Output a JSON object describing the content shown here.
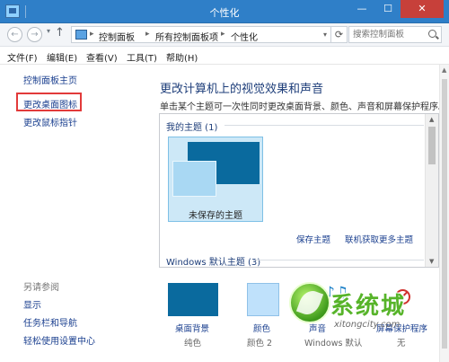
{
  "window": {
    "title": "个性化",
    "minimize_glyph": "—",
    "maximize_glyph": "☐",
    "close_glyph": "✕"
  },
  "address": {
    "back_glyph": "←",
    "forward_glyph": "→",
    "up_glyph": "↑",
    "breadcrumbs": [
      "控制面板",
      "所有控制面板项",
      "个性化"
    ],
    "separator": "▸",
    "dropdown_glyph": "▾",
    "refresh_glyph": "⟳",
    "search_placeholder": "搜索控制面板"
  },
  "menu": [
    "文件(F)",
    "编辑(E)",
    "查看(V)",
    "工具(T)",
    "帮助(H)"
  ],
  "sidebar": {
    "links": [
      "控制面板主页",
      "更改桌面图标",
      "更改鼠标指针"
    ],
    "see_also_label": "另请参阅",
    "see_also_links": [
      "显示",
      "任务栏和导航",
      "轻松使用设置中心"
    ]
  },
  "main": {
    "heading": "更改计算机上的视觉效果和声音",
    "subtext": "单击某个主题可一次性同时更改桌面背景、颜色、声音和屏幕保护程序。",
    "my_themes_label": "我的主题 (1)",
    "unsaved_theme": "未保存的主题",
    "save_theme": "保存主题",
    "get_more_themes": "联机获取更多主题",
    "windows_themes_label": "Windows 默认主题 (3)",
    "scroll_up_glyph": "▲",
    "scroll_down_glyph": "▼"
  },
  "settings": [
    {
      "label": "桌面背景",
      "value": "纯色",
      "swatch": "#0a6a9e"
    },
    {
      "label": "颜色",
      "value": "颜色 2",
      "swatch": "#bfe1fb"
    },
    {
      "label": "声音",
      "value": "Windows 默认",
      "icon": "music-notes-icon"
    },
    {
      "label": "屏幕保护程序",
      "value": "无",
      "icon": "screensaver-icon"
    }
  ],
  "watermark": {
    "text": "系统城",
    "subtext": "xitongcity.com"
  },
  "colors": {
    "titlebar": "#2f7fc8",
    "link": "#1a3f8f",
    "heading": "#1e3e7a",
    "highlight_box": "#e23a3a"
  }
}
